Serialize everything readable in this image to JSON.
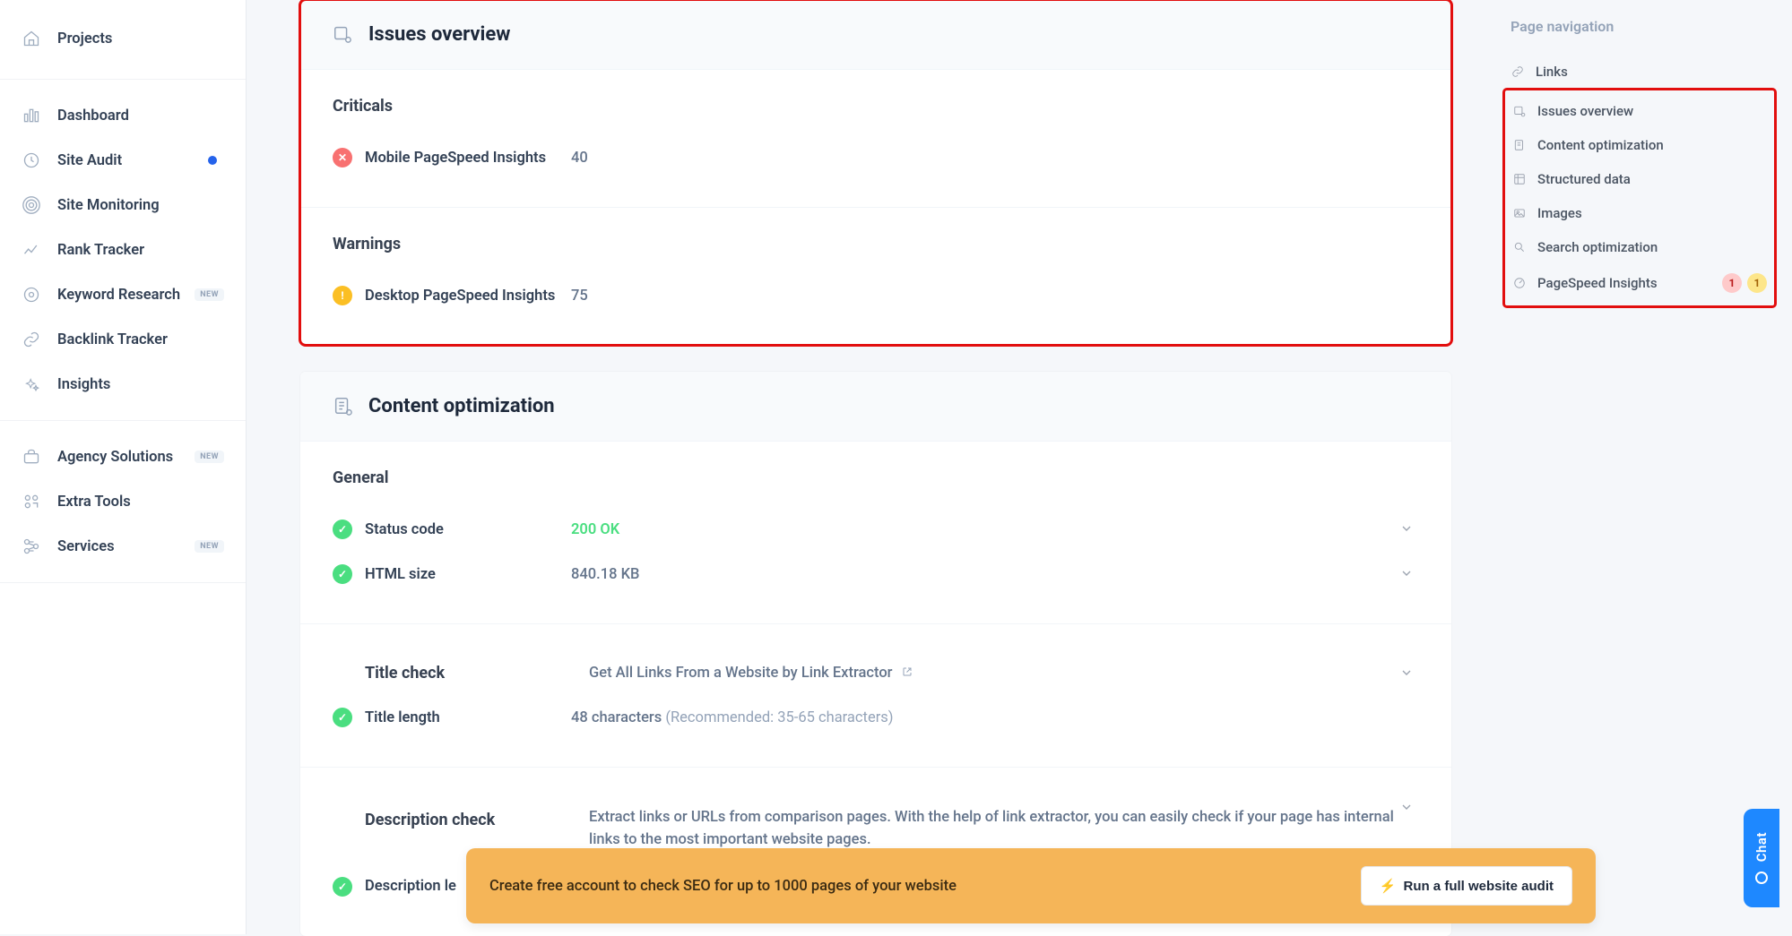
{
  "sidebar": {
    "top_item": {
      "label": "Projects"
    },
    "section1": [
      {
        "label": "Dashboard",
        "icon": "dashboard"
      },
      {
        "label": "Site Audit",
        "icon": "audit",
        "dot": true
      },
      {
        "label": "Site Monitoring",
        "icon": "monitoring"
      },
      {
        "label": "Rank Tracker",
        "icon": "rank"
      },
      {
        "label": "Keyword Research",
        "icon": "keyword",
        "badge": "NEW"
      },
      {
        "label": "Backlink Tracker",
        "icon": "backlink"
      },
      {
        "label": "Insights",
        "icon": "insights"
      }
    ],
    "section2": [
      {
        "label": "Agency Solutions",
        "icon": "agency",
        "badge": "NEW"
      },
      {
        "label": "Extra Tools",
        "icon": "tools"
      },
      {
        "label": "Services",
        "icon": "services",
        "badge": "NEW"
      }
    ]
  },
  "issues_card": {
    "title": "Issues overview",
    "criticals_label": "Criticals",
    "criticals": [
      {
        "label": "Mobile PageSpeed Insights",
        "value": "40"
      }
    ],
    "warnings_label": "Warnings",
    "warnings": [
      {
        "label": "Desktop PageSpeed Insights",
        "value": "75"
      }
    ]
  },
  "content_card": {
    "title": "Content optimization",
    "general_label": "General",
    "general": [
      {
        "label": "Status code",
        "value": "200 OK",
        "green": true
      },
      {
        "label": "HTML size",
        "value": "840.18 KB"
      }
    ],
    "title_check": {
      "heading": "Title check",
      "value_main": "Get All Links From a Website by Link Extractor",
      "row_label": "Title length",
      "row_value": "48 characters",
      "row_hint": "(Recommended: 35-65 characters)"
    },
    "description_check": {
      "heading": "Description check",
      "value_main": "Extract links or URLs from comparison pages. With the help of link extractor, you can easily check if your page has internal links to the most important website pages.",
      "row_label": "Description le"
    }
  },
  "pagenav": {
    "title": "Page navigation",
    "top_item": {
      "label": "Links",
      "icon": "link"
    },
    "items": [
      {
        "label": "Issues overview",
        "icon": "issues"
      },
      {
        "label": "Content optimization",
        "icon": "content"
      },
      {
        "label": "Structured data",
        "icon": "structured"
      },
      {
        "label": "Images",
        "icon": "images"
      },
      {
        "label": "Search optimization",
        "icon": "search"
      },
      {
        "label": "PageSpeed Insights",
        "icon": "speed",
        "badge_red": "1",
        "badge_yellow": "1"
      }
    ]
  },
  "cta": {
    "text": "Create free account to check SEO for up to 1000 pages of your website",
    "button": "Run a full website audit"
  },
  "chat": {
    "label": "Chat"
  }
}
